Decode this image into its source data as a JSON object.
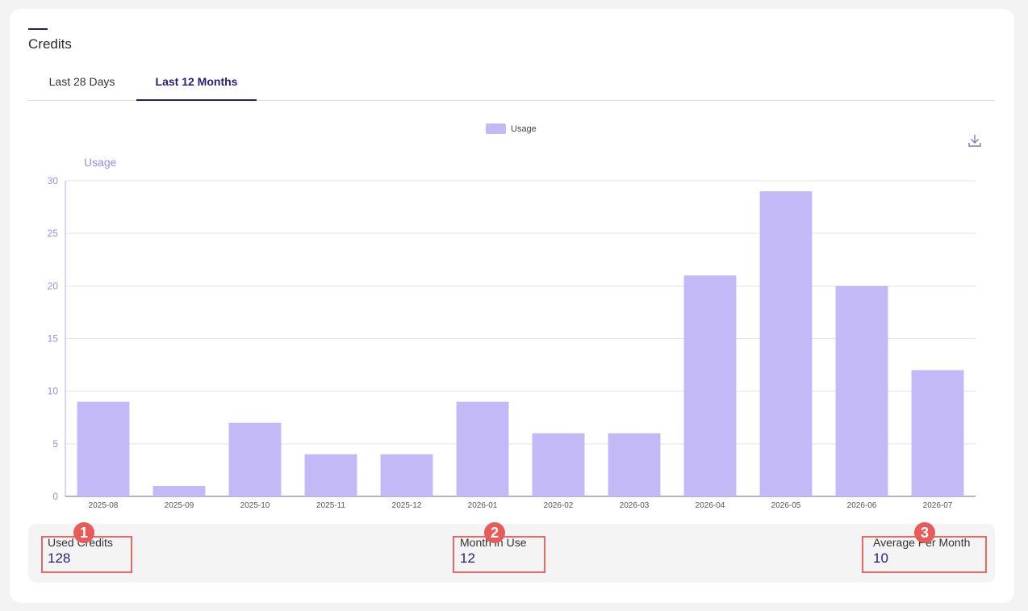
{
  "card": {
    "title": "Credits",
    "tabs": [
      {
        "label": "Last 28 Days",
        "active": false
      },
      {
        "label": "Last 12 Months",
        "active": true
      }
    ]
  },
  "chart_data": {
    "type": "bar",
    "categories": [
      "2025-08",
      "2025-09",
      "2025-10",
      "2025-11",
      "2025-12",
      "2026-01",
      "2026-02",
      "2026-03",
      "2026-04",
      "2026-05",
      "2026-06",
      "2026-07"
    ],
    "series": [
      {
        "name": "Usage",
        "values": [
          9,
          1,
          7,
          4,
          4,
          9,
          6,
          6,
          21,
          29,
          20,
          12
        ],
        "color": "#c2b9f6"
      }
    ],
    "ylabel": "Usage",
    "ylim": [
      0,
      30
    ],
    "yticks": [
      0,
      5,
      10,
      15,
      20,
      25,
      30
    ],
    "grid": true,
    "legend": "top-center"
  },
  "toolbar": {
    "download_icon": "download-icon"
  },
  "stats": {
    "used_credits": {
      "label": "Used Credits",
      "value": "128",
      "badge": "1"
    },
    "months_in_use": {
      "label": "Month in Use",
      "value": "12",
      "badge": "2"
    },
    "avg_per_month": {
      "label": "Average Per Month",
      "value": "10",
      "badge": "3"
    }
  },
  "colors": {
    "accent": "#2b1a7a",
    "bar": "#c2b9f6",
    "axis_label": "#9a8de6",
    "highlight": "#e86767"
  }
}
